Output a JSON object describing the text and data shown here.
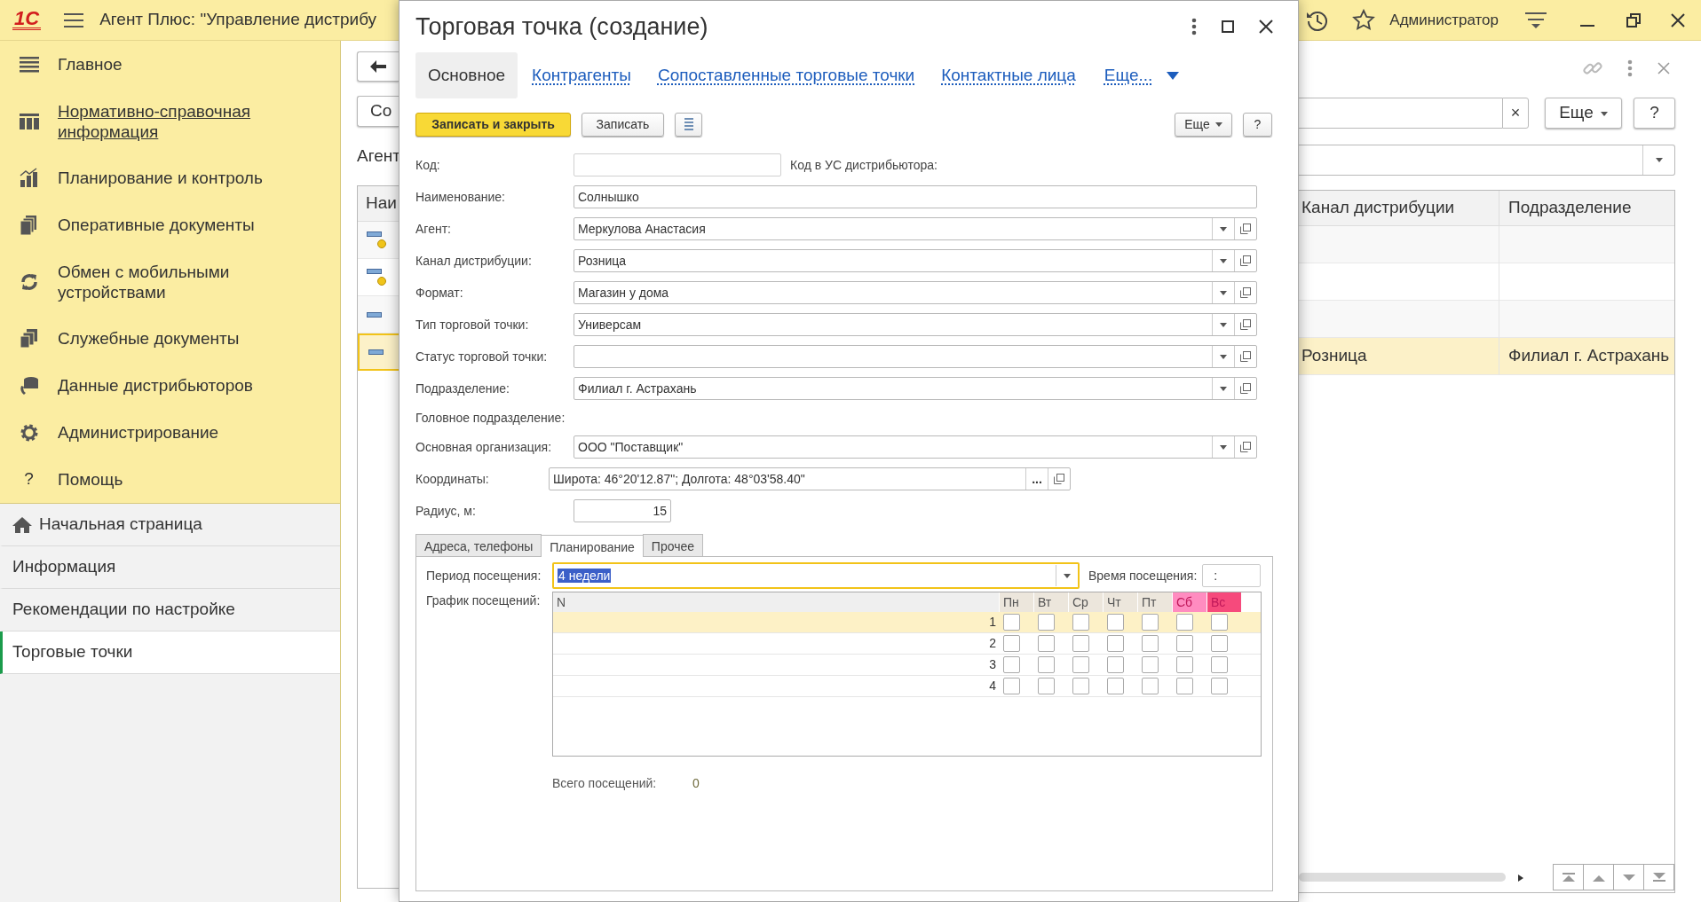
{
  "app_bar": {
    "logo": "1С",
    "title": "Агент Плюс: \"Управление дистрибу",
    "user": "Администратор"
  },
  "sidebar": {
    "sections": [
      {
        "label": "Главное",
        "hovered": false
      },
      {
        "label": "Нормативно-справочная информация",
        "hovered": true
      },
      {
        "label": "Планирование и контроль",
        "hovered": false
      },
      {
        "label": "Оперативные документы",
        "hovered": false
      },
      {
        "label": "Обмен с мобильными устройствами",
        "hovered": false
      },
      {
        "label": "Служебные документы",
        "hovered": false
      },
      {
        "label": "Данные дистрибьюторов",
        "hovered": false
      },
      {
        "label": "Администрирование",
        "hovered": false
      },
      {
        "label": "Помощь",
        "hovered": false,
        "glyph": "?"
      }
    ],
    "nav": [
      {
        "label": "Начальная страница",
        "selected": false
      },
      {
        "label": "Информация",
        "selected": false
      },
      {
        "label": "Рекомендации по настройке",
        "selected": false
      },
      {
        "label": "Торговые точки",
        "selected": true
      }
    ]
  },
  "list": {
    "title": "Агент",
    "create_button": "Со",
    "clear_button": "×",
    "more_button": "Еще",
    "help_button": "?",
    "columns": [
      {
        "label": "Наи"
      },
      {
        "label": "Канал дистрибуции"
      },
      {
        "label": "Подразделение"
      }
    ],
    "rows": [
      {
        "marked": true,
        "selected": false
      },
      {
        "marked": true,
        "selected": false
      },
      {
        "marked": false,
        "selected": false
      },
      {
        "marked": false,
        "selected": true,
        "channel": "Розница",
        "division": "Филиал г. Астрахань"
      }
    ]
  },
  "dialog": {
    "title": "Торговая точка (создание)",
    "tabs": [
      {
        "label": "Основное",
        "selected": true
      },
      {
        "label": "Контрагенты",
        "selected": false
      },
      {
        "label": "Сопоставленные торговые точки",
        "selected": false
      },
      {
        "label": "Контактные лица",
        "selected": false
      }
    ],
    "more_tab": "Еще...",
    "toolbar": {
      "save_close": "Записать и закрыть",
      "save": "Записать",
      "more": "Еще",
      "help": "?"
    },
    "fields": [
      {
        "kind": "code",
        "label": "Код:",
        "side_label": "Код в УС дистрибьютора:"
      },
      {
        "kind": "text",
        "label": "Наименование:",
        "value": "Солнышко"
      },
      {
        "kind": "select",
        "label": "Агент:",
        "value": "Меркулова Анастасия"
      },
      {
        "kind": "select",
        "label": "Канал дистрибуции:",
        "value": "Розница"
      },
      {
        "kind": "select",
        "label": "Формат:",
        "value": "Магазин у дома"
      },
      {
        "kind": "select",
        "label": "Тип торговой точки:",
        "value": "Универсам"
      },
      {
        "kind": "select",
        "label": "Статус торговой точки:"
      },
      {
        "kind": "select",
        "label": "Подразделение:",
        "value": "Филиал г. Астрахань"
      },
      {
        "kind": "caption",
        "label": "Головное подразделение:"
      },
      {
        "kind": "select",
        "label": "Основная организация:",
        "value": "ООО \"Поставщик\""
      },
      {
        "kind": "coords",
        "label": "Координаты:",
        "value": "Широта: 46°20'12.87\"; Долгота: 48°03'58.40\"",
        "button": "..."
      },
      {
        "kind": "number",
        "label": "Радиус, м:",
        "value": "15"
      }
    ],
    "inner_tabs": [
      {
        "label": "Адреса, телефоны",
        "selected": false
      },
      {
        "label": "Планирование",
        "selected": true
      },
      {
        "label": "Прочее",
        "selected": false
      }
    ],
    "period": {
      "label": "Период посещения:",
      "value": "4 недели",
      "focused": true
    },
    "visit_time": {
      "label": "Время посещения:",
      "value": ":"
    },
    "schedule": {
      "label": "График посещений:",
      "columns": [
        {
          "label": "N"
        },
        {
          "label": "Пн",
          "color": "#ece6dc"
        },
        {
          "label": "Вт",
          "color": "#ece6dc"
        },
        {
          "label": "Ср",
          "color": "#ece6dc"
        },
        {
          "label": "Чт",
          "color": "#ece6dc"
        },
        {
          "label": "Пт",
          "color": "#ece6dc"
        },
        {
          "label": "Сб",
          "color": "#ff8cc0"
        },
        {
          "label": "Вс",
          "color": "#f64a7c"
        }
      ],
      "rows": [
        {
          "label": "1",
          "selected": true,
          "checks": [
            false,
            false,
            false,
            false,
            false,
            false,
            false
          ]
        },
        {
          "label": "2",
          "selected": false,
          "checks": [
            false,
            false,
            false,
            false,
            false,
            false,
            false
          ]
        },
        {
          "label": "3",
          "selected": false,
          "checks": [
            false,
            false,
            false,
            false,
            false,
            false,
            false
          ]
        },
        {
          "label": "4",
          "selected": false,
          "checks": [
            false,
            false,
            false,
            false,
            false,
            false,
            false
          ]
        }
      ]
    },
    "total": {
      "label": "Всего посещений:",
      "value": "0"
    }
  }
}
